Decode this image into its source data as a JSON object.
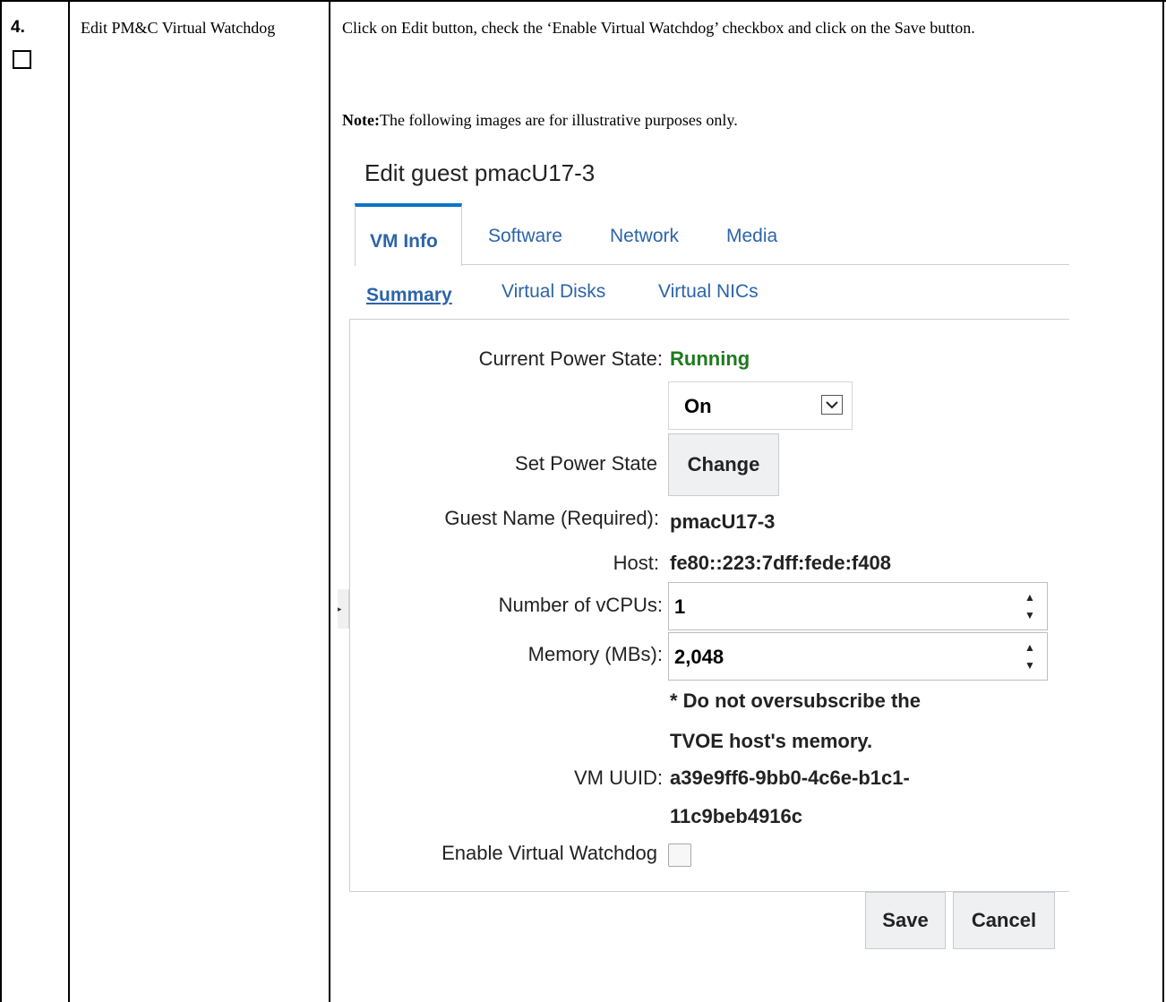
{
  "step": {
    "number": "4.",
    "title": "Edit PM&C Virtual Watchdog",
    "instruction": "Click on Edit button, check the ‘Enable Virtual Watchdog’ checkbox and click on the Save button.",
    "note_label": "Note:",
    "note_text": "The following images are for illustrative purposes only."
  },
  "dialog": {
    "title": "Edit guest pmacU17-3",
    "tabs": [
      {
        "label": "VM Info",
        "active": true
      },
      {
        "label": "Software",
        "active": false
      },
      {
        "label": "Network",
        "active": false
      },
      {
        "label": "Media",
        "active": false
      }
    ],
    "subtabs": [
      {
        "label": "Summary",
        "active": true
      },
      {
        "label": "Virtual Disks",
        "active": false
      },
      {
        "label": "Virtual NICs",
        "active": false
      }
    ],
    "fields": {
      "current_power_state_label": "Current Power State:",
      "current_power_state_value": "Running",
      "power_select_value": "On",
      "set_power_state_label": "Set Power State",
      "change_button": "Change",
      "guest_name_label": "Guest Name (Required):",
      "guest_name_value": "pmacU17-3",
      "host_label": "Host:",
      "host_value": "fe80::223:7dff:fede:f408",
      "vcpus_label": "Number of vCPUs:",
      "vcpus_value": "1",
      "memory_label": "Memory (MBs):",
      "memory_value": "2,048",
      "memory_warning_line1": "* Do not oversubscribe the",
      "memory_warning_line2": "TVOE host's memory.",
      "uuid_label": "VM UUID:",
      "uuid_line1": "a39e9ff6-9bb0-4c6e-b1c1-",
      "uuid_line2": "11c9beb4916c",
      "watchdog_label": "Enable Virtual Watchdog",
      "watchdog_checked": false
    },
    "buttons": {
      "save": "Save",
      "cancel": "Cancel"
    },
    "icons": {
      "spin_up": "▲",
      "spin_down": "▼",
      "select_arrow": "chevron-down-icon",
      "collapse_handle": "▸"
    }
  }
}
